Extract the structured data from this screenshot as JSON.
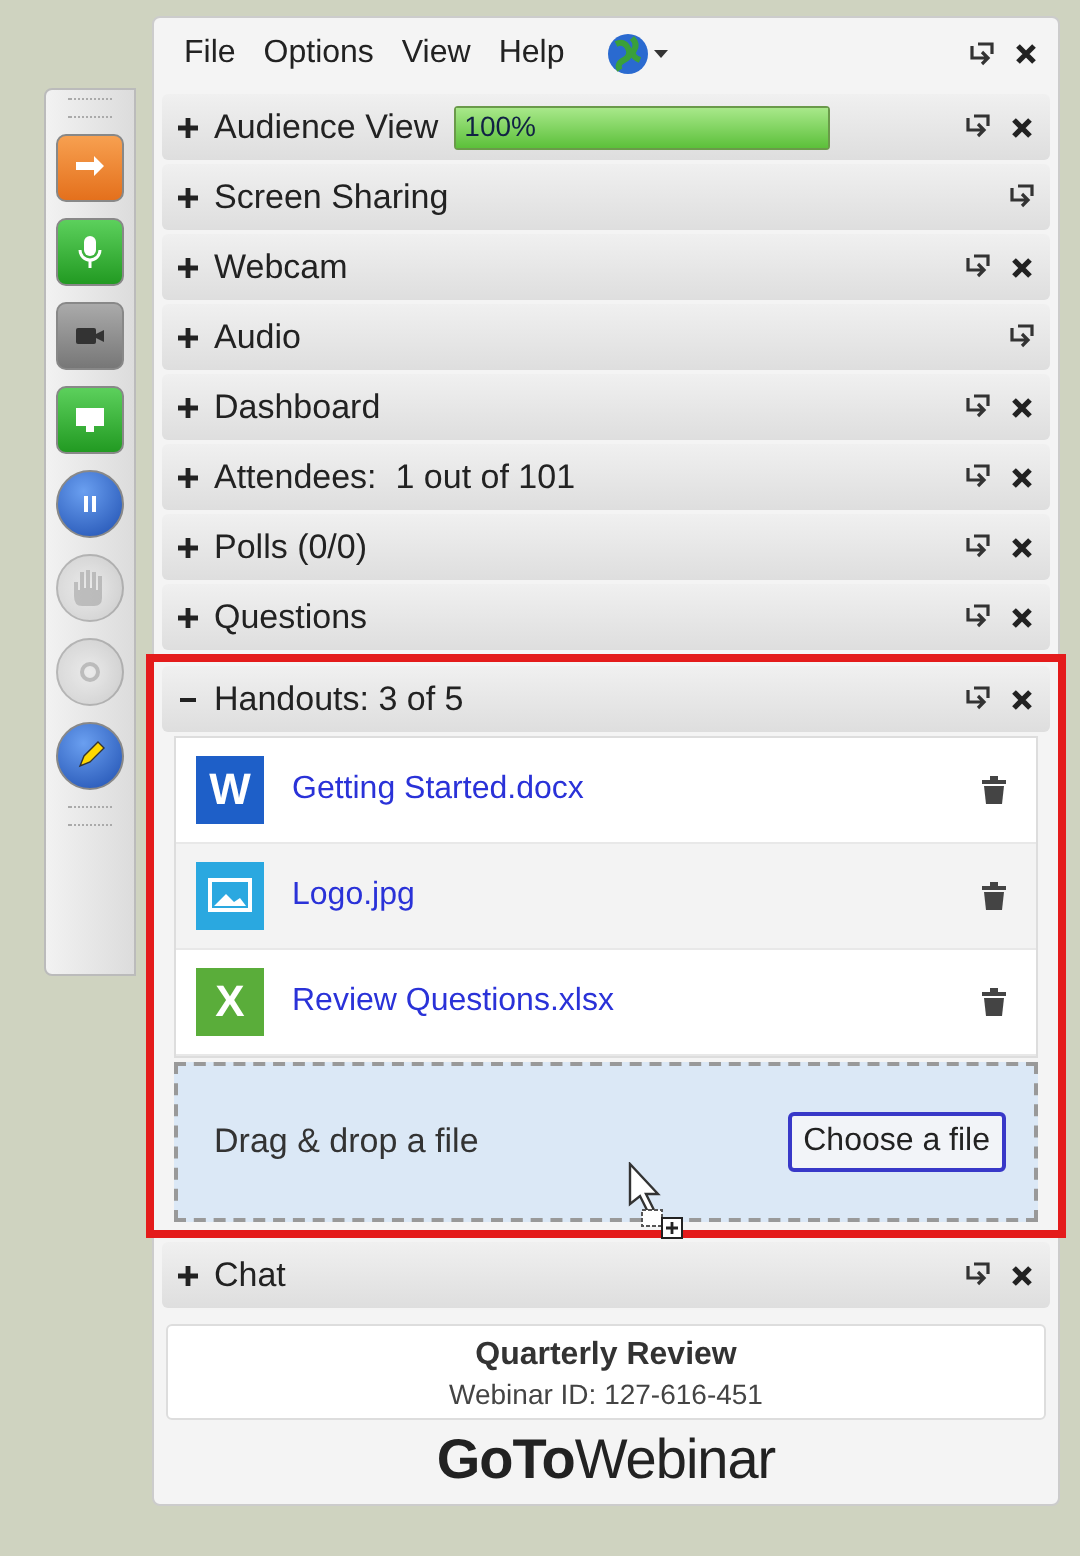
{
  "menu": {
    "items": [
      "File",
      "Options",
      "View",
      "Help"
    ]
  },
  "toolbar": [
    {
      "kind": "arrow",
      "disabled": false
    },
    {
      "kind": "mic",
      "disabled": false
    },
    {
      "kind": "webcam",
      "disabled": false
    },
    {
      "kind": "screen",
      "disabled": false
    },
    {
      "kind": "pause",
      "disabled": false
    },
    {
      "kind": "hand",
      "disabled": true
    },
    {
      "kind": "record",
      "disabled": true
    },
    {
      "kind": "pen",
      "disabled": false
    }
  ],
  "panels": [
    {
      "title": "Audience View",
      "expanded": false,
      "closable": true,
      "progress": {
        "level": 1,
        "text": "100%"
      }
    },
    {
      "title": "Screen Sharing",
      "expanded": false,
      "closable": false
    },
    {
      "title": "Webcam",
      "expanded": false,
      "closable": true
    },
    {
      "title": "Audio",
      "expanded": false,
      "closable": false
    },
    {
      "title": "Dashboard",
      "expanded": false,
      "closable": true
    },
    {
      "title": "Attendees:  1 out of 101",
      "expanded": false,
      "closable": true
    },
    {
      "title": "Polls (0/0)",
      "expanded": false,
      "closable": true
    },
    {
      "title": "Questions",
      "expanded": false,
      "closable": true
    },
    {
      "title": "Handouts: 3 of 5",
      "expanded": true,
      "closable": true,
      "highlighted": true,
      "files": [
        {
          "kind": "word",
          "badge": "W",
          "name": "Getting Started.docx"
        },
        {
          "kind": "image",
          "name": "Logo.jpg"
        },
        {
          "kind": "excel",
          "badge": "X",
          "name": "Review Questions.xlsx"
        }
      ],
      "dropzone": {
        "text": "Drag & drop a file",
        "button": "Choose a file"
      }
    },
    {
      "title": "Chat",
      "expanded": false,
      "closable": true
    }
  ],
  "footer": {
    "title": "Quarterly Review",
    "subtitle": "Webinar ID: 127-616-451",
    "logo": "**GoTo**Webinar"
  }
}
